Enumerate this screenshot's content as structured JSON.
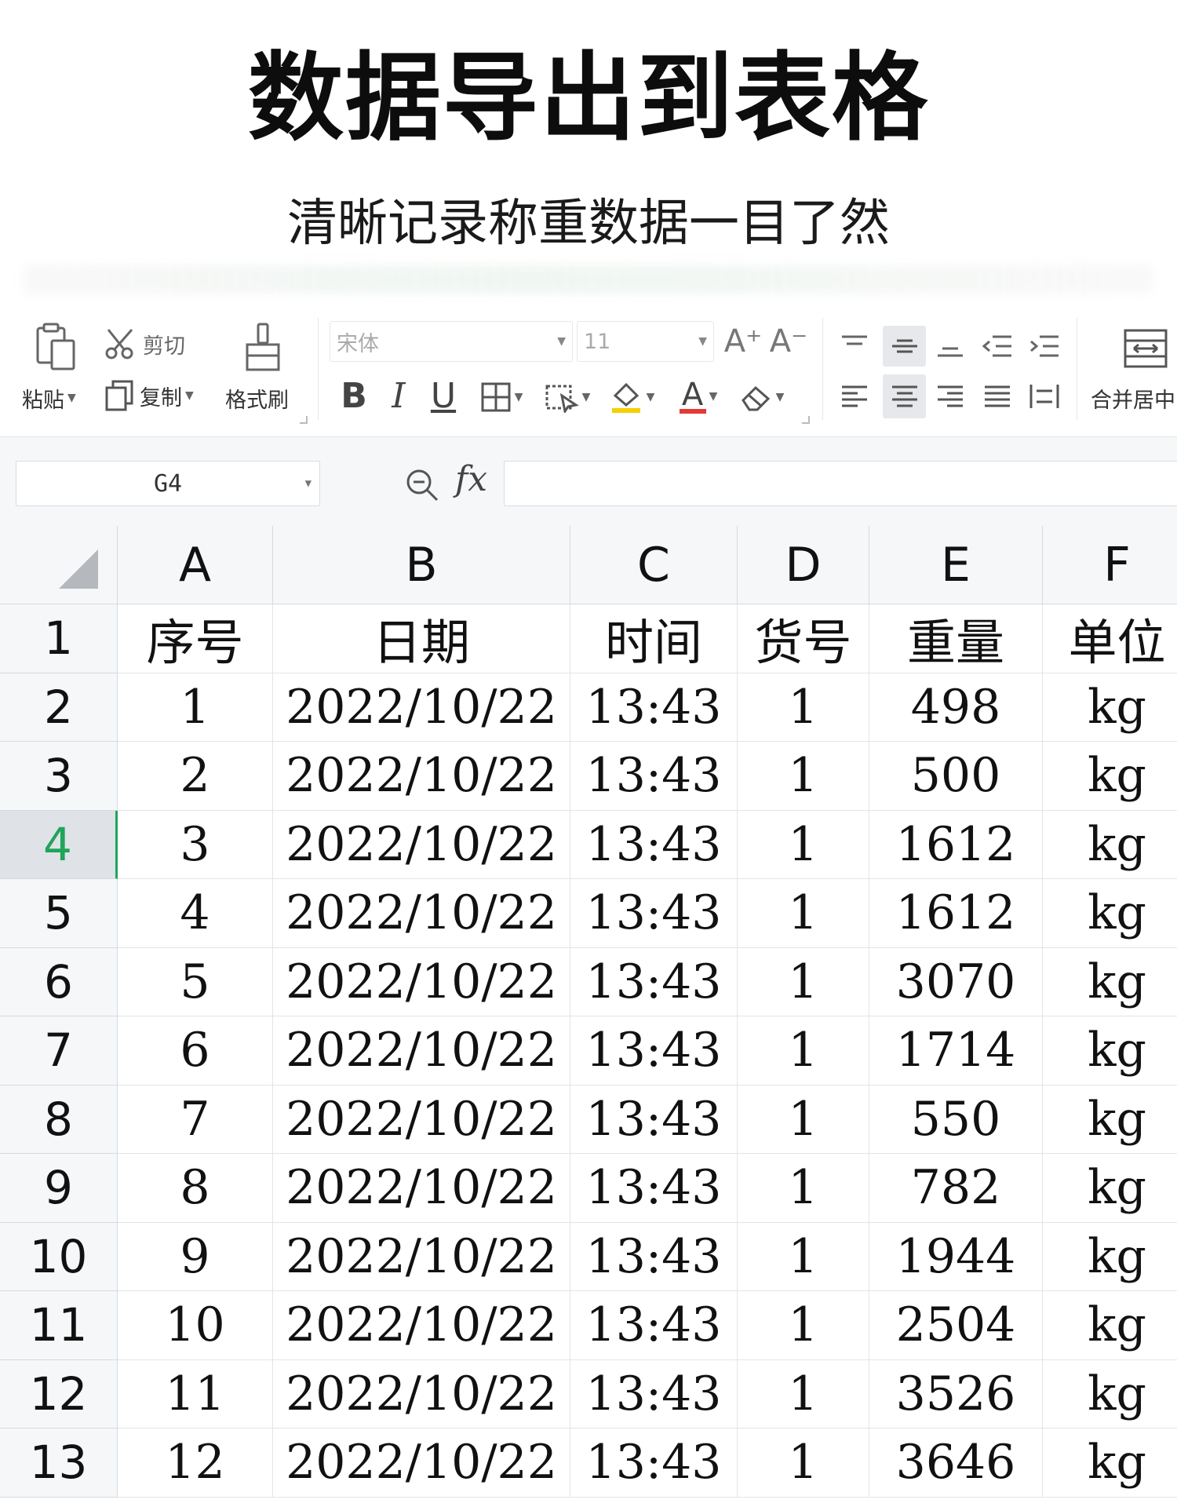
{
  "promo": {
    "title": "数据导出到表格",
    "subtitle": "清晰记录称重数据一目了然"
  },
  "ribbon": {
    "paste": "粘贴",
    "cut": "剪切",
    "copy": "复制",
    "format_painter": "格式刷",
    "font_name": "宋体",
    "font_size": "11",
    "bold": "B",
    "italic": "I",
    "underline": "U",
    "font_color_glyph": "A",
    "increase_font_glyph": "A⁺",
    "decrease_font_glyph": "A⁻",
    "merge_center": "合并居中",
    "font_color": "#e53935",
    "highlight_color": "#f5d000"
  },
  "formula_bar": {
    "name_box": "G4",
    "fx": "fx",
    "formula": ""
  },
  "sheet": {
    "selected_row": "4",
    "accent": "#1fa45a",
    "columns": [
      "A",
      "B",
      "C",
      "D",
      "E",
      "F"
    ],
    "row_numbers": [
      "1",
      "2",
      "3",
      "4",
      "5",
      "6",
      "7",
      "8",
      "9",
      "10",
      "11",
      "12",
      "13"
    ],
    "rows": [
      [
        "序号",
        "日期",
        "时间",
        "货号",
        "重量",
        "单位"
      ],
      [
        "1",
        "2022/10/22",
        "13:43",
        "1",
        "498",
        "kg"
      ],
      [
        "2",
        "2022/10/22",
        "13:43",
        "1",
        "500",
        "kg"
      ],
      [
        "3",
        "2022/10/22",
        "13:43",
        "1",
        "1612",
        "kg"
      ],
      [
        "4",
        "2022/10/22",
        "13:43",
        "1",
        "1612",
        "kg"
      ],
      [
        "5",
        "2022/10/22",
        "13:43",
        "1",
        "3070",
        "kg"
      ],
      [
        "6",
        "2022/10/22",
        "13:43",
        "1",
        "1714",
        "kg"
      ],
      [
        "7",
        "2022/10/22",
        "13:43",
        "1",
        "550",
        "kg"
      ],
      [
        "8",
        "2022/10/22",
        "13:43",
        "1",
        "782",
        "kg"
      ],
      [
        "9",
        "2022/10/22",
        "13:43",
        "1",
        "1944",
        "kg"
      ],
      [
        "10",
        "2022/10/22",
        "13:43",
        "1",
        "2504",
        "kg"
      ],
      [
        "11",
        "2022/10/22",
        "13:43",
        "1",
        "3526",
        "kg"
      ],
      [
        "12",
        "2022/10/22",
        "13:43",
        "1",
        "3646",
        "kg"
      ]
    ]
  }
}
